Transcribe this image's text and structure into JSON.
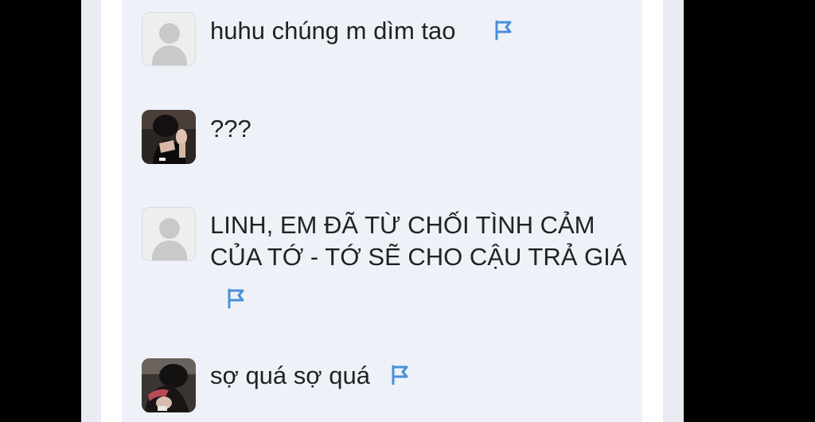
{
  "comments": [
    {
      "text_lines": [
        "huhu chúng m dìm tao"
      ],
      "avatar": "default-user-icon",
      "has_flag": true
    },
    {
      "text_lines": [
        "???"
      ],
      "avatar": "user-photo",
      "has_flag": false
    },
    {
      "text_lines": [
        "LINH, EM ĐÃ TỪ CHỐI TÌNH CẢM",
        "CỦA TỚ - TỚ SẼ CHO CẬU TRẢ GIÁ"
      ],
      "avatar": "default-user-icon",
      "has_flag": true
    },
    {
      "text_lines": [
        "sợ quá sợ quá"
      ],
      "avatar": "user-photo",
      "has_flag": true
    }
  ],
  "icons": {
    "flag": "flag-icon",
    "default_avatar": "user-silhouette-icon"
  },
  "colors": {
    "flag": "#4a90d9",
    "text": "#222222",
    "comment_background": "#eef2f8",
    "outer_background": "#000000"
  }
}
